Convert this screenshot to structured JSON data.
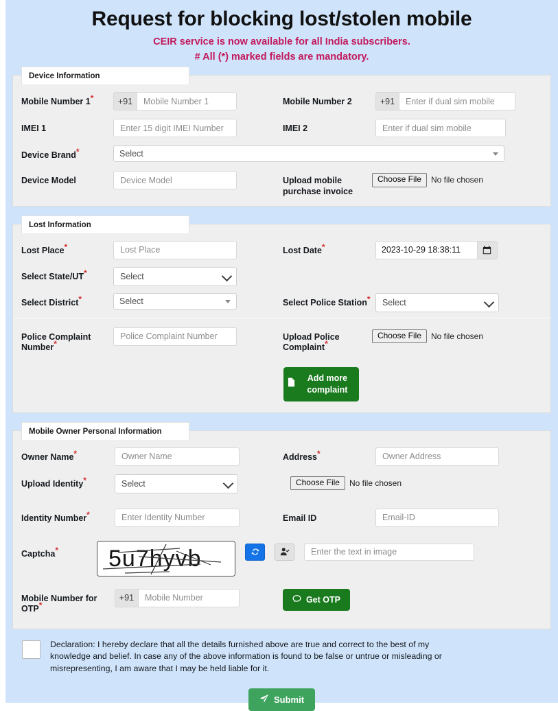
{
  "header": {
    "title": "Request for blocking lost/stolen mobile",
    "subtitle1": "CEIR service is now available for all India subscribers.",
    "subtitle2": "# All (*) marked fields are mandatory."
  },
  "device_section": {
    "legend": "Device Information",
    "mobile1_label": "Mobile Number 1",
    "mobile1_prefix": "+91",
    "mobile1_placeholder": "Mobile Number 1",
    "mobile2_label": "Mobile Number 2",
    "mobile2_prefix": "+91",
    "mobile2_placeholder": "Enter if dual sim mobile",
    "imei1_label": "IMEI 1",
    "imei1_placeholder": "Enter 15 digit IMEI Number",
    "imei2_label": "IMEI 2",
    "imei2_placeholder": "Enter if dual sim mobile",
    "brand_label": "Device Brand",
    "brand_value": "Select",
    "model_label": "Device Model",
    "model_placeholder": "Device Model",
    "invoice_label": "Upload mobile purchase invoice",
    "invoice_button": "Choose File",
    "invoice_status": "No file chosen"
  },
  "lost_section": {
    "legend": "Lost Information",
    "lost_place_label": "Lost Place",
    "lost_place_placeholder": "Lost Place",
    "lost_date_label": "Lost Date",
    "lost_date_value": "2023-10-29 18:38:11",
    "state_label": "Select State/UT",
    "state_value": "Select",
    "district_label": "Select District",
    "district_value": "Select",
    "police_station_label": "Select Police Station",
    "police_station_value": "Select",
    "complaint_number_label": "Police Complaint Number",
    "complaint_number_placeholder": "Police Complaint Number",
    "upload_complaint_label": "Upload Police Complaint",
    "upload_complaint_button": "Choose File",
    "upload_complaint_status": "No file chosen",
    "add_more_label": "Add more complaint"
  },
  "owner_section": {
    "legend": "Mobile Owner Personal Information",
    "owner_name_label": "Owner Name",
    "owner_name_placeholder": "Owner Name",
    "address_label": "Address",
    "address_placeholder": "Owner Address",
    "upload_identity_label": "Upload Identity",
    "upload_identity_value": "Select",
    "identity_file_button": "Choose File",
    "identity_file_status": "No file chosen",
    "identity_number_label": "Identity Number",
    "identity_number_placeholder": "Enter Identity Number",
    "email_label": "Email ID",
    "email_placeholder": "Email-ID",
    "captcha_label": "Captcha",
    "captcha_text": "5u7hyvb",
    "captcha_input_placeholder": "Enter the text in image",
    "otp_mobile_label": "Mobile Number for OTP",
    "otp_mobile_prefix": "+91",
    "otp_mobile_placeholder": "Mobile Number",
    "get_otp_label": "Get OTP"
  },
  "footer": {
    "declaration": "Declaration: I hereby declare that all the details furnished above are true and correct to the best of my knowledge and belief. In case any of the above information is found to be false or untrue or misleading or misrepresenting, I am aware that I may be held liable for it.",
    "submit_label": "Submit"
  },
  "colors": {
    "page_background": "#cfe4fb",
    "panel_background": "#efeff0",
    "accent_red": "#c2185b",
    "green_dark": "#1a7a1e",
    "green_submit": "#3da35d",
    "blue_refresh": "#1473e6",
    "required_star": "#d32f2f"
  }
}
